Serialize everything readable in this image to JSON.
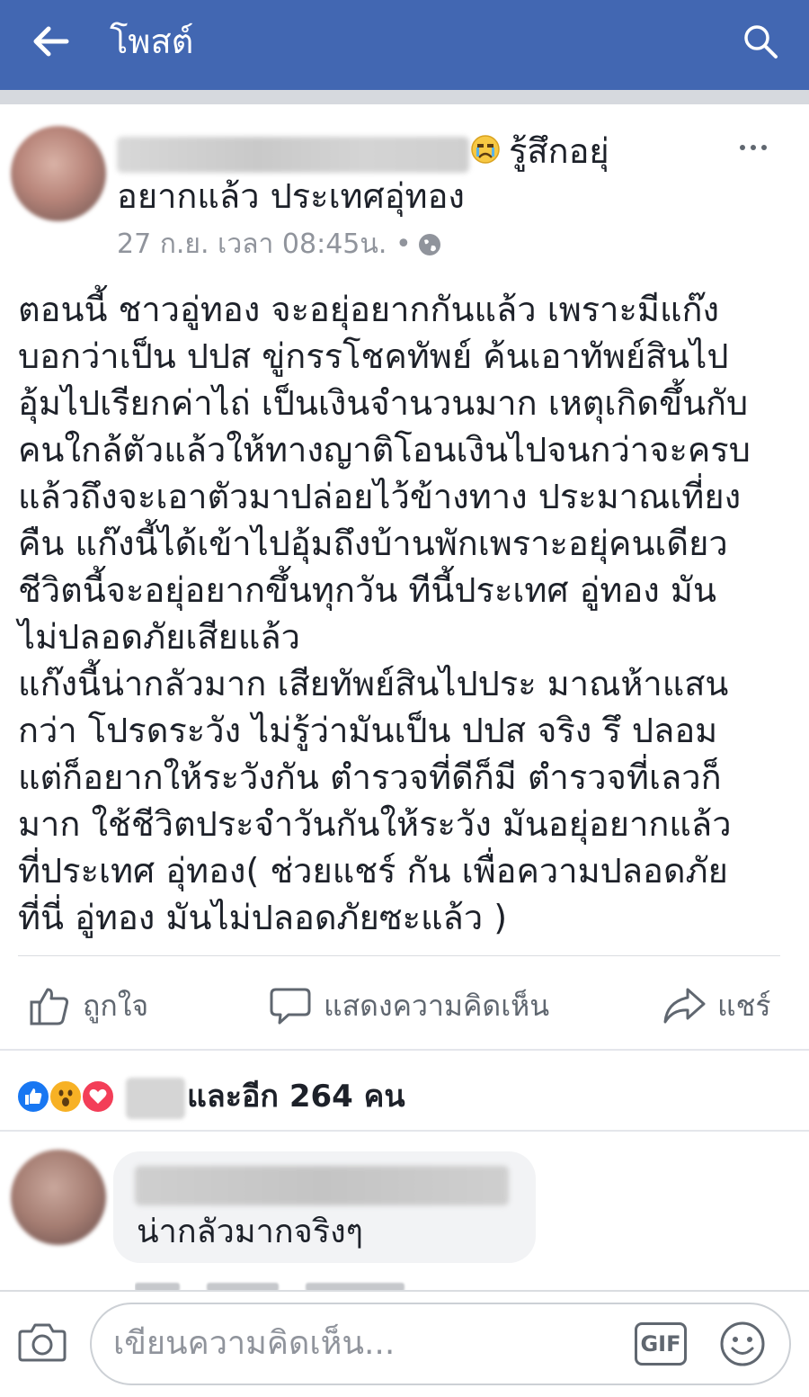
{
  "topbar": {
    "title": "โพสต์",
    "back_icon": "arrow-left-icon",
    "search_icon": "search-icon"
  },
  "post": {
    "feeling_line1": "รู้สึกอยุ่",
    "feeling_line2": "อยากแล้ว ประเทศอุ่ทอง",
    "meta": "27 ก.ย. เวลา 08:45น. •",
    "body_lines": [
      "ตอนนี้ ชาวอู่ทอง จะอยุ่อยากกันแล้ว เพราะมีแก๊ง",
      "บอกว่าเป็น ปปส ขู่กรรโชคทัพย์ ค้นเอาทัพย์สินไป",
      "อุ้มไปเรียกค่าไถ่ เป็นเงินจำนวนมาก เหตุเกิดขึ้นกับ",
      "คนใกล้ตัวแล้วให้ทางญาติโอนเงินไปจนกว่าจะครบ",
      "แล้วถึงจะเอาตัวมาปล่อยไว้ข้างทาง ประมาณเที่ยง",
      "คืน แก๊งนี้ได้เข้าไปอุ้มถึงบ้านพักเพราะอยุ่คนเดียว",
      "ชีวิตนี้จะอยุ่อยากขึ้นทุกวัน ทีนี้ประเทศ อู่ทอง มัน",
      "ไม่ปลอดภัยเสียแล้ว",
      "แก๊งนี้น่ากลัวมาก เสียทัพย์สินไปประ มาณห้าแสน",
      "กว่า โปรดระวัง ไม่รู้ว่ามันเป็น ปปส จริง รึ ปลอม",
      "แต่ก็อยากให้ระวังกัน ตำรวจที่ดีก็มี ตำรวจที่เลวก็",
      "มาก ใช้ชีวิตประจำวันกันให้ระวัง มันอยุ่อยากแล้ว",
      "ที่ประเทศ อุ่ทอง( ช่วยแชร์ กัน เพื่อความปลอดภัย",
      "ที่นี่ อู่ทอง มันไม่ปลอดภัยซะแล้ว )"
    ]
  },
  "actions": {
    "like": "ถูกใจ",
    "comment": "แสดงความคิดเห็น",
    "share": "แชร์"
  },
  "reactions": {
    "summary": "และอีก 264 คน",
    "types": [
      "like-reaction-icon",
      "wow-reaction-icon",
      "love-reaction-icon"
    ],
    "colors": {
      "like": "#1877f2",
      "wow": "#f7b125",
      "love": "#f33e58"
    }
  },
  "comment": {
    "text": "น่ากลัวมากจริงๆ"
  },
  "composer": {
    "placeholder": "เขียนความคิดเห็น...",
    "gif_label": "GIF"
  },
  "colors": {
    "brand": "#4267b2"
  }
}
